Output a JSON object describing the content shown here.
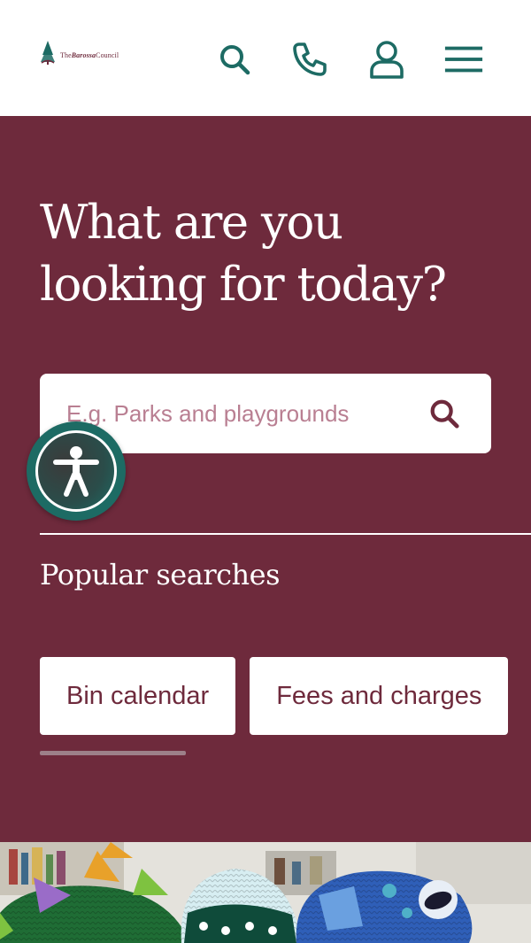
{
  "header": {
    "logo": {
      "text_prefix": "The",
      "text_emphasis": "Barossa",
      "text_suffix": "Council",
      "icon": "tree-logo-icon"
    },
    "icons": [
      {
        "name": "search-icon",
        "label": "Search"
      },
      {
        "name": "phone-icon",
        "label": "Contact"
      },
      {
        "name": "user-icon",
        "label": "Account"
      },
      {
        "name": "menu-icon",
        "label": "Menu"
      }
    ]
  },
  "hero": {
    "title_line1": "What are you",
    "title_line2": "looking for today?",
    "search": {
      "placeholder": "E.g. Parks and playgrounds",
      "value": "",
      "submit_icon": "search-icon"
    },
    "popular_heading": "Popular searches",
    "popular_searches": [
      {
        "label": "Bin calendar"
      },
      {
        "label": "Fees and charges"
      }
    ],
    "chip_scroll_progress": 0.3
  },
  "accessibility": {
    "icon": "accessibility-person-icon"
  },
  "colors": {
    "brand_maroon": "#6e2a3c",
    "brand_green": "#1d6b64",
    "placeholder": "#b97f92",
    "white": "#ffffff"
  }
}
